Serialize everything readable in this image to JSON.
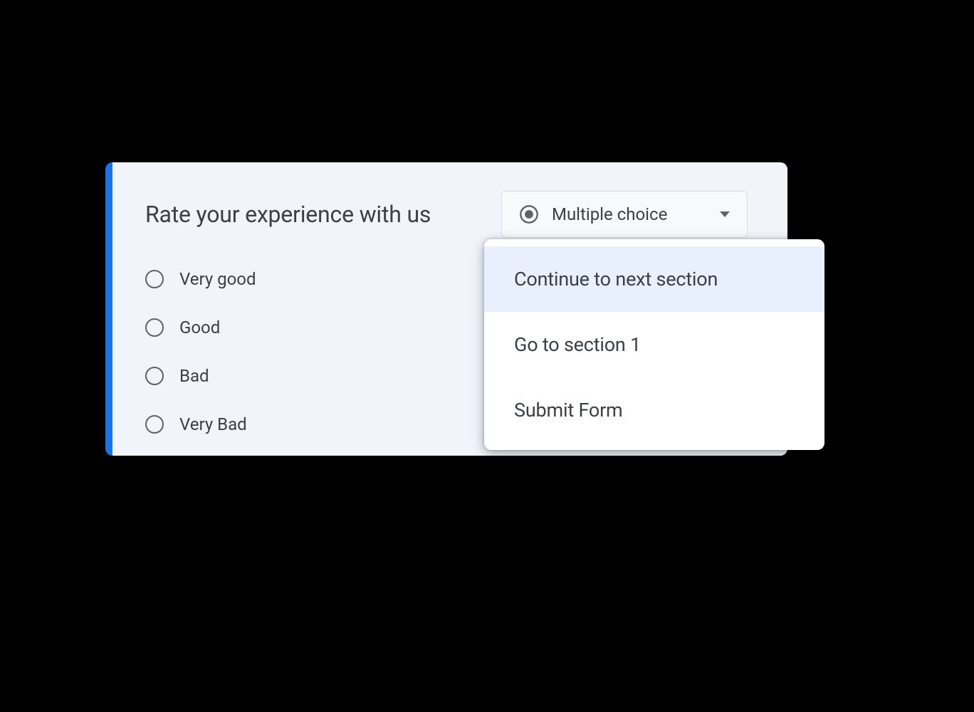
{
  "question": {
    "title": "Rate your experience with us",
    "type_selector": {
      "label": "Multiple choice",
      "icon": "radio-selected-icon"
    },
    "options": [
      {
        "label": "Very good"
      },
      {
        "label": "Good"
      },
      {
        "label": "Bad"
      },
      {
        "label": "Very Bad"
      }
    ]
  },
  "navigation_dropdown": {
    "items": [
      {
        "label": "Continue to next section",
        "selected": true
      },
      {
        "label": "Go to section 1",
        "selected": false
      },
      {
        "label": "Submit Form",
        "selected": false
      }
    ]
  }
}
